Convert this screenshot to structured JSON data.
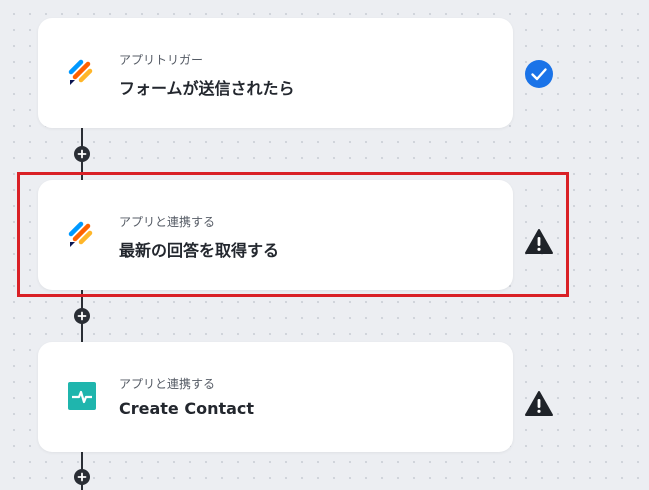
{
  "flow": {
    "steps": [
      {
        "label": "アプリトリガー",
        "title": "フォームが送信されたら",
        "app_icon": "jotform-icon",
        "status": "completed"
      },
      {
        "label": "アプリと連携する",
        "title": "最新の回答を取得する",
        "app_icon": "jotform-icon",
        "status": "warning"
      },
      {
        "label": "アプリと連携する",
        "title": "Create Contact",
        "app_icon": "teal-app-icon",
        "status": "warning"
      }
    ],
    "colors": {
      "check": "#1a73e8",
      "warning": "#1f2329",
      "highlight": "#d92026",
      "jotform_orange": "#ff6100",
      "jotform_yellow": "#ffb629",
      "jotform_blue": "#0099ff",
      "teal_app": "#1fb5ad"
    }
  }
}
